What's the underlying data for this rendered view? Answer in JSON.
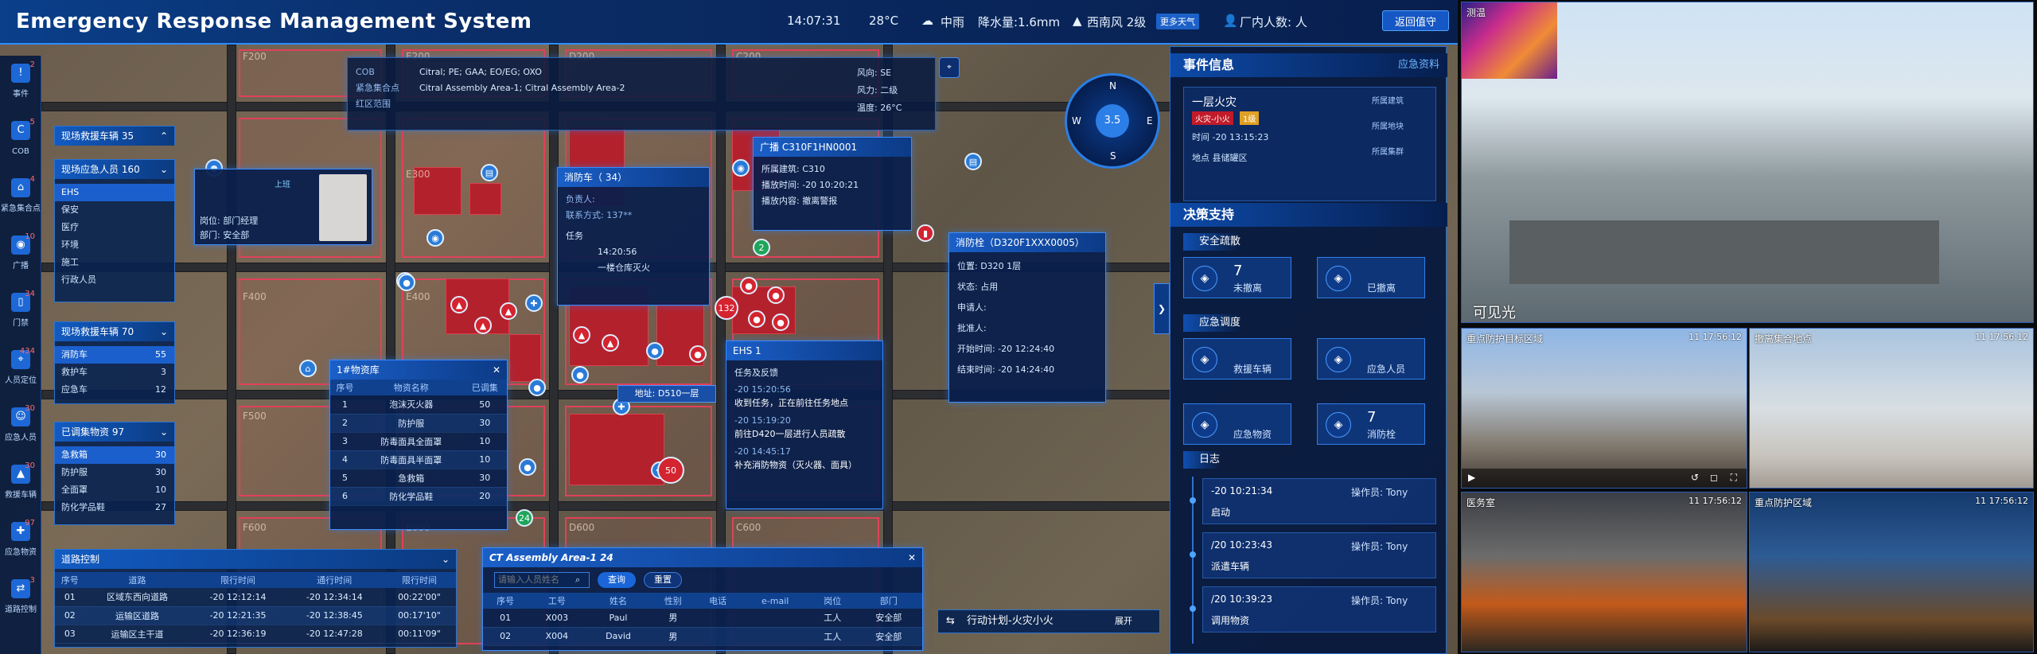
{
  "header": {
    "title": "Emergency Response Management System",
    "time": "14:07:31",
    "temperature": "28°C",
    "rain": "中雨",
    "precip": "降水量:1.6mm",
    "wind": "西南风 2级",
    "more_weather": "更多天气",
    "people_count": "厂内人数:  人",
    "back_button": "返回值守"
  },
  "nav": [
    {
      "label": "事件",
      "icon": "event-icon",
      "count": "2"
    },
    {
      "label": "COB",
      "icon": "cob-icon",
      "count": "5"
    },
    {
      "label": "紧急集合点",
      "icon": "assembly-icon",
      "count": "4"
    },
    {
      "label": "广播",
      "icon": "broadcast-icon",
      "count": "10"
    },
    {
      "label": "门禁",
      "icon": "access-icon",
      "count": "34"
    },
    {
      "label": "人员定位",
      "icon": "locate-icon",
      "count": "434"
    },
    {
      "label": "应急人员",
      "icon": "staff-icon",
      "count": "30"
    },
    {
      "label": "救援车辆",
      "icon": "truck-icon",
      "count": "30"
    },
    {
      "label": "应急物资",
      "icon": "supplies-icon",
      "count": "97"
    },
    {
      "label": "道路控制",
      "icon": "road-icon",
      "count": "3"
    }
  ],
  "left_panels": {
    "rescue_vehicles_top": "现场救援车辆 35",
    "personnel": {
      "title": "现场应急人员 160",
      "items": [
        "EHS",
        "保安",
        "医疗",
        "环境",
        "施工",
        "行政人员"
      ]
    },
    "vehicles": {
      "title": "现场救援车辆 70",
      "items": [
        {
          "name": "消防车",
          "value": "55"
        },
        {
          "name": "救护车",
          "value": "3"
        },
        {
          "name": "应急车",
          "value": "12"
        }
      ]
    },
    "supplies": {
      "title": "已调集物资 97",
      "items": [
        {
          "name": "急救箱",
          "value": "30"
        },
        {
          "name": "防护服",
          "value": "30"
        },
        {
          "name": "全面罩",
          "value": "10"
        },
        {
          "name": "防化学品鞋",
          "value": "27"
        }
      ]
    }
  },
  "cob_info": {
    "cob_label": "COB",
    "cob_value": "Citral; PE; GAA; EO/EG; OXO",
    "assembly_label": "紧急集合点",
    "assembly_value": "Citral Assembly Area-1; Citral Assembly Area-2",
    "redzone_label": "红区范围",
    "wind_dir": "风向: SE",
    "wind_level": "风力: 二级",
    "temp": "温度: 26°C"
  },
  "person_card": {
    "role_tag": "上班",
    "post": "岗位: 部门经理",
    "dept": "部门: 安全部"
  },
  "fire_truck": {
    "title": "消防车（ 34）",
    "leader": "负责人:",
    "contact": "联系方式: 137**",
    "task_label": "任务",
    "task_time": "14:20:56",
    "task_desc": "一楼仓库灭火"
  },
  "broadcast": {
    "title": "广播 C310F1HN0001",
    "building": "所属建筑: C310",
    "time": "播放时间: -20 10:20:21",
    "content": "播放内容: 撤离警报"
  },
  "hydrant": {
    "title": "消防栓（D320F1XXX0005）",
    "location": "位置: D320 1层",
    "status": "状态: 占用",
    "applicant": "申请人:",
    "approver": "批准人:",
    "start": "开始时间: -20 12:24:40",
    "end": "结束时间: -20 14:24:40"
  },
  "ehs": {
    "title": "EHS 1",
    "feedback": "任务及反馈",
    "entries": [
      {
        "time": "-20 15:20:56",
        "text": "收到任务，正在前往任务地点"
      },
      {
        "time": "-20 15:19:20",
        "text": "前往D420一层进行人员疏散"
      },
      {
        "time": "-20 14:45:17",
        "text": "补充消防物资（灭火器、面具）"
      }
    ]
  },
  "address_tag": "地址: D510一层",
  "warehouse": {
    "title": "1#物资库",
    "headers": [
      "序号",
      "物资名称",
      "已调集"
    ],
    "rows": [
      [
        "1",
        "泡沫灭火器",
        "50"
      ],
      [
        "2",
        "防护服",
        "30"
      ],
      [
        "3",
        "防毒面具全面罩",
        "10"
      ],
      [
        "4",
        "防毒面具半面罩",
        "10"
      ],
      [
        "5",
        "急救箱",
        "30"
      ],
      [
        "6",
        "防化学品鞋",
        "20"
      ]
    ]
  },
  "road_control": {
    "title": "道路控制",
    "headers": [
      "序号",
      "道路",
      "限行时间",
      "通行时间",
      "限行时间"
    ],
    "rows": [
      [
        "01",
        "区域东西向道路",
        "-20 12:12:14",
        "-20 12:34:14",
        "00:22'00\""
      ],
      [
        "02",
        "运输区道路",
        "-20 12:21:35",
        "-20 12:38:45",
        "00:17'10\""
      ],
      [
        "03",
        "运输区主干道",
        "-20 12:36:19",
        "-20 12:47:28",
        "00:11'09\""
      ]
    ]
  },
  "assembly_list": {
    "title": "CT Assembly Area-1 24",
    "search_placeholder": "请输入人员姓名",
    "query_button": "查询",
    "reset_button": "重置",
    "headers": [
      "序号",
      "工号",
      "姓名",
      "性别",
      "电话",
      "e-mail",
      "岗位",
      "部门"
    ],
    "rows": [
      [
        "01",
        "X003",
        "Paul",
        "男",
        "",
        "",
        "工人",
        "安全部"
      ],
      [
        "02",
        "X004",
        "David",
        "男",
        "",
        "",
        "工人",
        "安全部"
      ]
    ]
  },
  "action_plan": {
    "label": "行动计划-火灾小火",
    "expand": "展开"
  },
  "map_labels": [
    "F200",
    "E200",
    "D200",
    "C200",
    "E300",
    "F400",
    "E400",
    "F500",
    "F600",
    "E600",
    "D600",
    "C600"
  ],
  "compass": {
    "level": "3.5",
    "n": "N",
    "s": "S",
    "w": "W",
    "e": "E"
  },
  "event": {
    "section_title": "事件信息",
    "link": "应急资料",
    "name": "一层火灾",
    "tag1": "火灾-小火",
    "tag2": "1级",
    "time": "时间 -20 13:15:23",
    "place": "地点 县储罐区",
    "side": [
      "所属建筑",
      "所属地块",
      "所属集群"
    ]
  },
  "decision": {
    "title": "决策支持",
    "evac_title": "安全疏散",
    "evac": [
      {
        "value": "7",
        "label": "未撤离"
      },
      {
        "value": "",
        "label": "已撤离"
      }
    ],
    "dispatch_title": "应急调度",
    "dispatch": [
      {
        "value": "",
        "label": "救援车辆"
      },
      {
        "value": "",
        "label": "应急人员"
      },
      {
        "value": "",
        "label": "应急物资"
      },
      {
        "value": "7",
        "label": "消防栓"
      }
    ],
    "log_title": "日志",
    "logs": [
      {
        "time": "-20 10:21:34",
        "op": "操作员: Tony",
        "action": "启动"
      },
      {
        "time": "/20 10:23:43",
        "op": "操作员: Tony",
        "action": "派遣车辆"
      },
      {
        "time": "/20 10:39:23",
        "op": "操作员: Tony",
        "action": "调用物资"
      }
    ]
  },
  "cameras": [
    {
      "name": "测温",
      "time": ""
    },
    {
      "name": "可见光",
      "time": ""
    },
    {
      "name": "重点防护目标区域",
      "time": "11 17:56:12"
    },
    {
      "name": "撤离集合地点",
      "time": "11 17:56:12"
    },
    {
      "name": "医务室",
      "time": "11 17:56:12"
    },
    {
      "name": "重点防护区域",
      "time": "11 17:56:12"
    }
  ],
  "colors": {
    "accent": "#2f8cff",
    "panel": "#08224f",
    "danger": "#d32430"
  }
}
